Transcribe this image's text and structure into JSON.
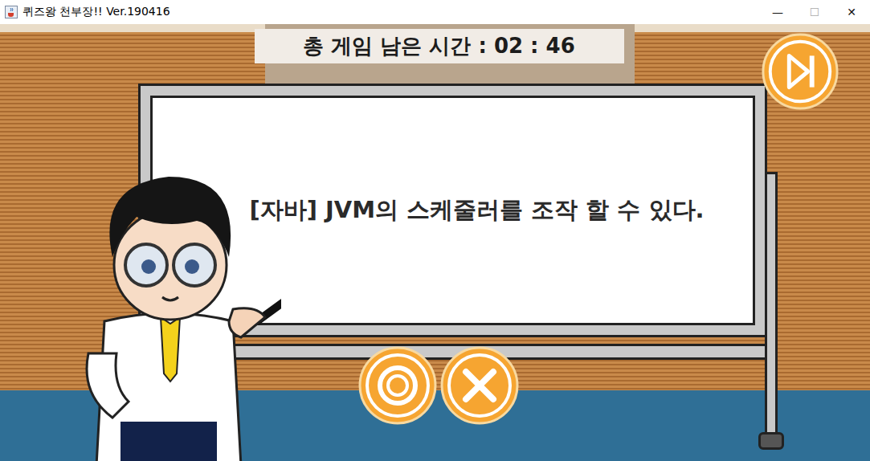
{
  "window": {
    "title": "퀴즈왕 천부장!! Ver.190416",
    "controls": [
      "—",
      "☐",
      "✕"
    ]
  },
  "timer": {
    "text": "총 게임 남은 시간 : 02 : 46"
  },
  "question": {
    "text": "[자바] JVM의 스케줄러를 조작 할 수 있다."
  }
}
